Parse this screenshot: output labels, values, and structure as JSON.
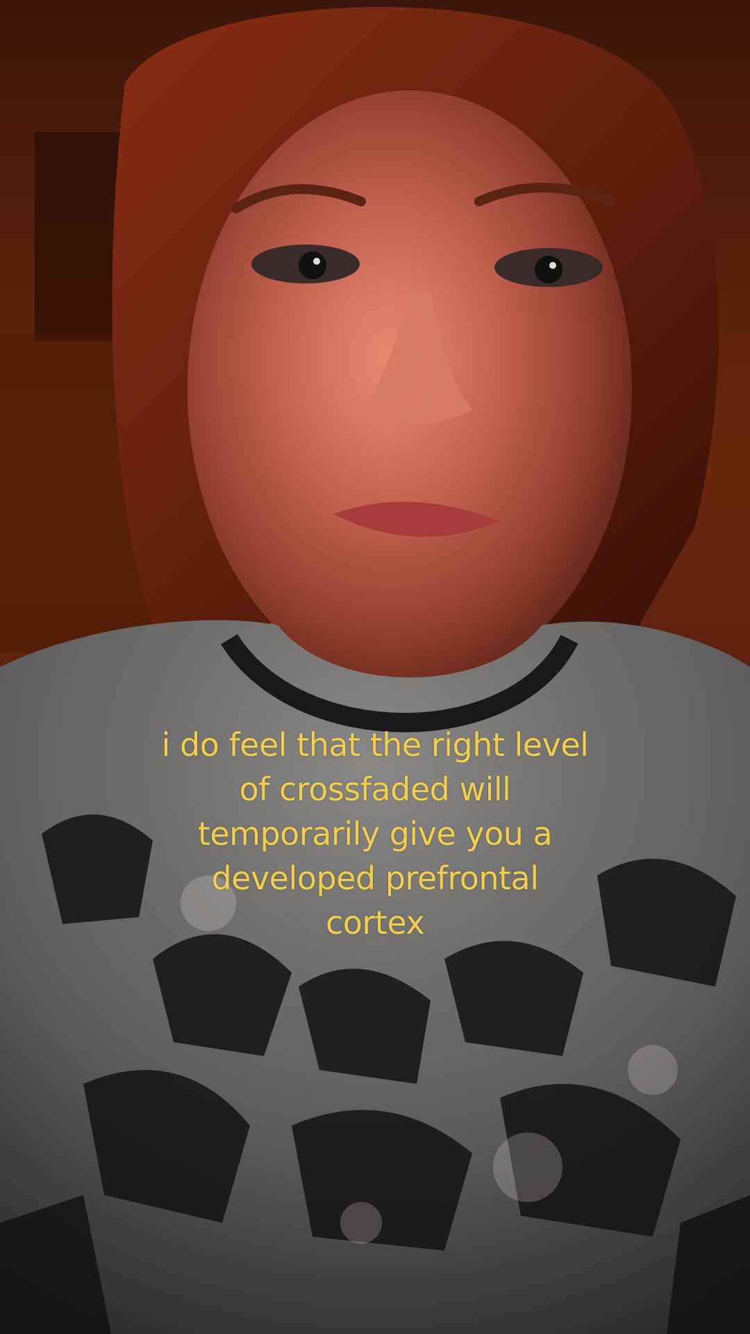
{
  "video": {
    "caption": "i do feel that the right level\nof crossfaded will\ntemporarily give you a\ndeveloped prefrontal\ncortex"
  },
  "colors": {
    "caption_text": "#f1cf4a",
    "background_warm": "#7a2a0e",
    "shirt_gray": "#6e6c6a"
  }
}
